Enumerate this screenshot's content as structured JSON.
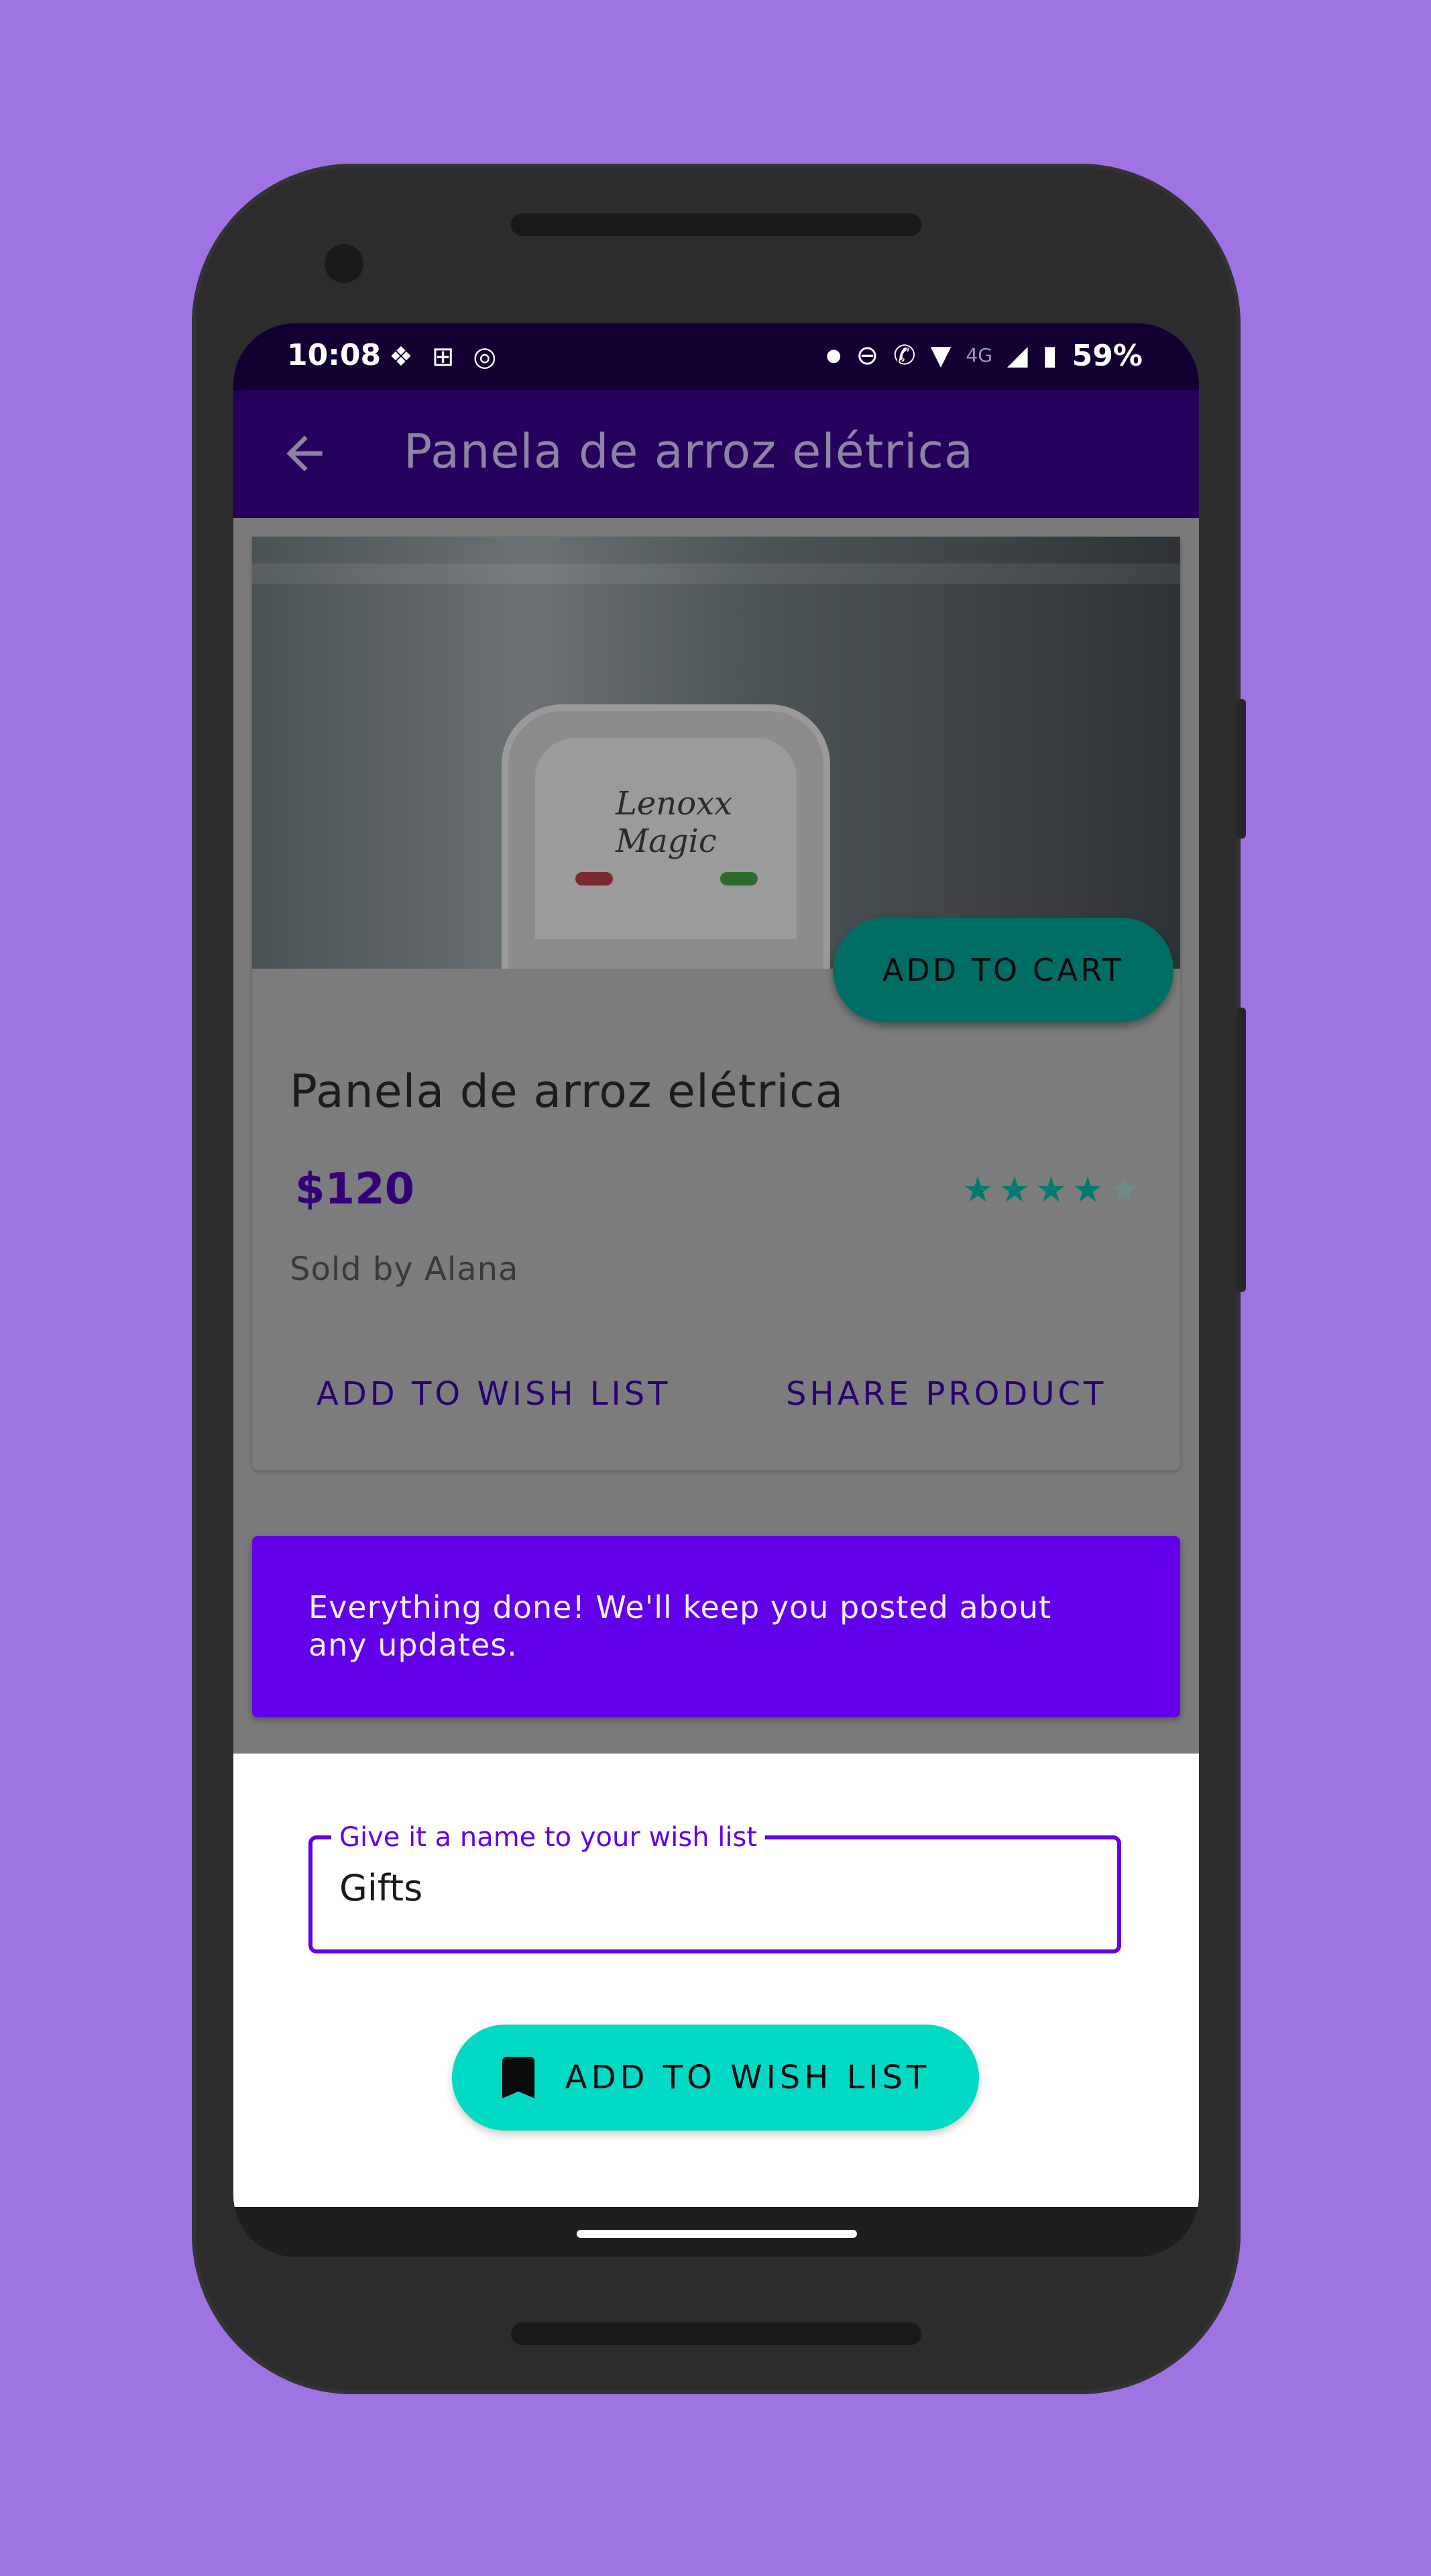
{
  "status_bar": {
    "time": "10:08",
    "battery": "59%",
    "network_label": "4G"
  },
  "app_bar": {
    "title": "Panela de arroz elétrica"
  },
  "product": {
    "image_logo": "Lenoxx Magic",
    "add_to_cart_label": "ADD TO CART",
    "title": "Panela de arroz elétrica",
    "price": "$120",
    "rating": 4,
    "rating_max": 5,
    "seller": "Sold by Alana",
    "wish_list_action": "ADD TO WISH LIST",
    "share_action": "SHARE PRODUCT"
  },
  "snackbar": {
    "message": "Everything done! We'll keep you posted about any updates."
  },
  "wish_sheet": {
    "field_label": "Give it a name to your wish list",
    "field_value": "Gifts",
    "button_label": "ADD TO WISH LIST"
  },
  "colors": {
    "background": "#a073e2",
    "app_bar": "#25005d",
    "primary": "#6200ea",
    "secondary": "#03dac5",
    "teal_dark": "#006e64"
  },
  "icons": {
    "back": "arrow-left-icon",
    "bookmark": "bookmark-icon",
    "star": "star-icon"
  }
}
